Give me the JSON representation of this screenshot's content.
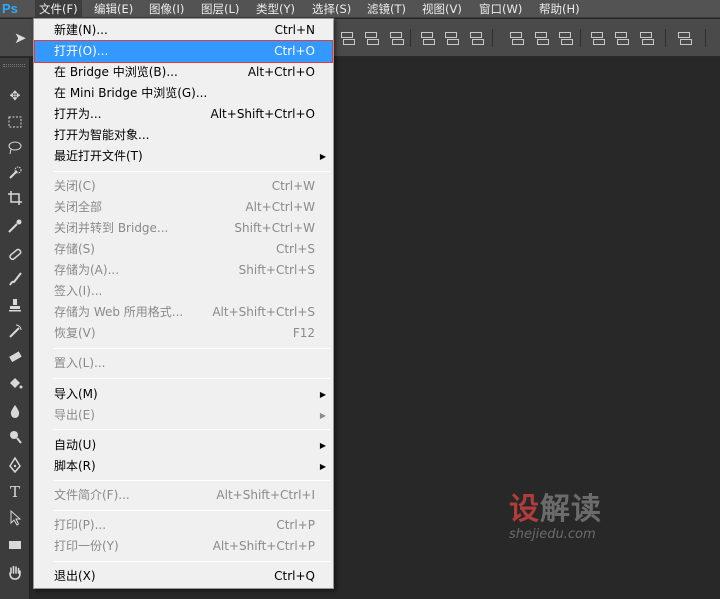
{
  "app": {
    "logo": "Ps"
  },
  "menubar": {
    "items": [
      {
        "label": "文件(F)"
      },
      {
        "label": "编辑(E)"
      },
      {
        "label": "图像(I)"
      },
      {
        "label": "图层(L)"
      },
      {
        "label": "类型(Y)"
      },
      {
        "label": "选择(S)"
      },
      {
        "label": "滤镜(T)"
      },
      {
        "label": "视图(V)"
      },
      {
        "label": "窗口(W)"
      },
      {
        "label": "帮助(H)"
      }
    ]
  },
  "file_menu": {
    "items": [
      {
        "label": "新建(N)...",
        "shortcut": "Ctrl+N"
      },
      {
        "label": "打开(O)...",
        "shortcut": "Ctrl+O",
        "highlighted": true
      },
      {
        "label": "在 Bridge 中浏览(B)...",
        "shortcut": "Alt+Ctrl+O"
      },
      {
        "label": "在 Mini Bridge 中浏览(G)...",
        "shortcut": ""
      },
      {
        "label": "打开为...",
        "shortcut": "Alt+Shift+Ctrl+O"
      },
      {
        "label": "打开为智能对象...",
        "shortcut": ""
      },
      {
        "label": "最近打开文件(T)",
        "shortcut": "",
        "submenu": true
      },
      {
        "label": "关闭(C)",
        "shortcut": "Ctrl+W",
        "disabled": true
      },
      {
        "label": "关闭全部",
        "shortcut": "Alt+Ctrl+W",
        "disabled": true
      },
      {
        "label": "关闭并转到 Bridge...",
        "shortcut": "Shift+Ctrl+W",
        "disabled": true
      },
      {
        "label": "存储(S)",
        "shortcut": "Ctrl+S",
        "disabled": true
      },
      {
        "label": "存储为(A)...",
        "shortcut": "Shift+Ctrl+S",
        "disabled": true
      },
      {
        "label": "签入(I)...",
        "shortcut": "",
        "disabled": true
      },
      {
        "label": "存储为 Web 所用格式...",
        "shortcut": "Alt+Shift+Ctrl+S",
        "disabled": true
      },
      {
        "label": "恢复(V)",
        "shortcut": "F12",
        "disabled": true
      },
      {
        "label": "置入(L)...",
        "shortcut": "",
        "disabled": true
      },
      {
        "label": "导入(M)",
        "shortcut": "",
        "submenu": true
      },
      {
        "label": "导出(E)",
        "shortcut": "",
        "submenu": true,
        "disabled": true
      },
      {
        "label": "自动(U)",
        "shortcut": "",
        "submenu": true
      },
      {
        "label": "脚本(R)",
        "shortcut": "",
        "submenu": true
      },
      {
        "label": "文件简介(F)...",
        "shortcut": "Alt+Shift+Ctrl+I",
        "disabled": true
      },
      {
        "label": "打印(P)...",
        "shortcut": "Ctrl+P",
        "disabled": true
      },
      {
        "label": "打印一份(Y)",
        "shortcut": "Alt+Shift+Ctrl+P",
        "disabled": true
      },
      {
        "label": "退出(X)",
        "shortcut": "Ctrl+Q"
      }
    ]
  },
  "watermark": {
    "title_first": "设",
    "title_rest": "解读",
    "subtitle": "shejiedu.com"
  },
  "colors": {
    "highlight": "#3399ff",
    "highlight_outline": "#e04040",
    "menu_bg": "#f0f0f0",
    "canvas_bg": "#282828",
    "ps_blue": "#31a8ff"
  }
}
